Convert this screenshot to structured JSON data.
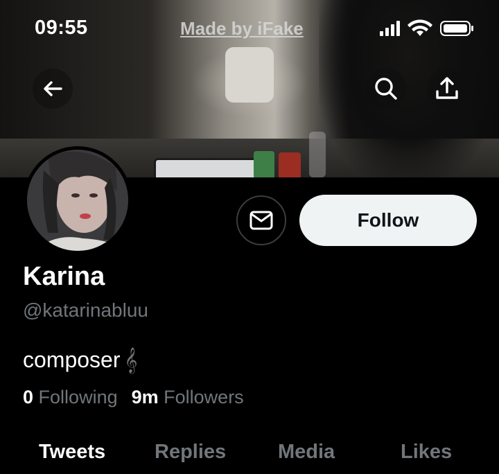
{
  "status_bar": {
    "time": "09:55",
    "watermark": "Made by iFake"
  },
  "header": {
    "back_icon": "arrow-left-icon",
    "search_icon": "search-icon",
    "share_icon": "share-icon"
  },
  "profile": {
    "name": "Karina",
    "handle": "@katarinabluu",
    "bio": "composer",
    "bio_emoji": "𝄞",
    "message_icon": "envelope-icon",
    "follow_label": "Follow",
    "following_count": "0",
    "following_label": "Following",
    "followers_count": "9m",
    "followers_label": "Followers"
  },
  "tabs": [
    {
      "label": "Tweets",
      "active": true
    },
    {
      "label": "Replies",
      "active": false
    },
    {
      "label": "Media",
      "active": false
    },
    {
      "label": "Likes",
      "active": false
    }
  ],
  "colors": {
    "background": "#000000",
    "primary_text": "#e7e9ea",
    "secondary_text": "#71767b",
    "follow_button_bg": "#eff3f4"
  }
}
